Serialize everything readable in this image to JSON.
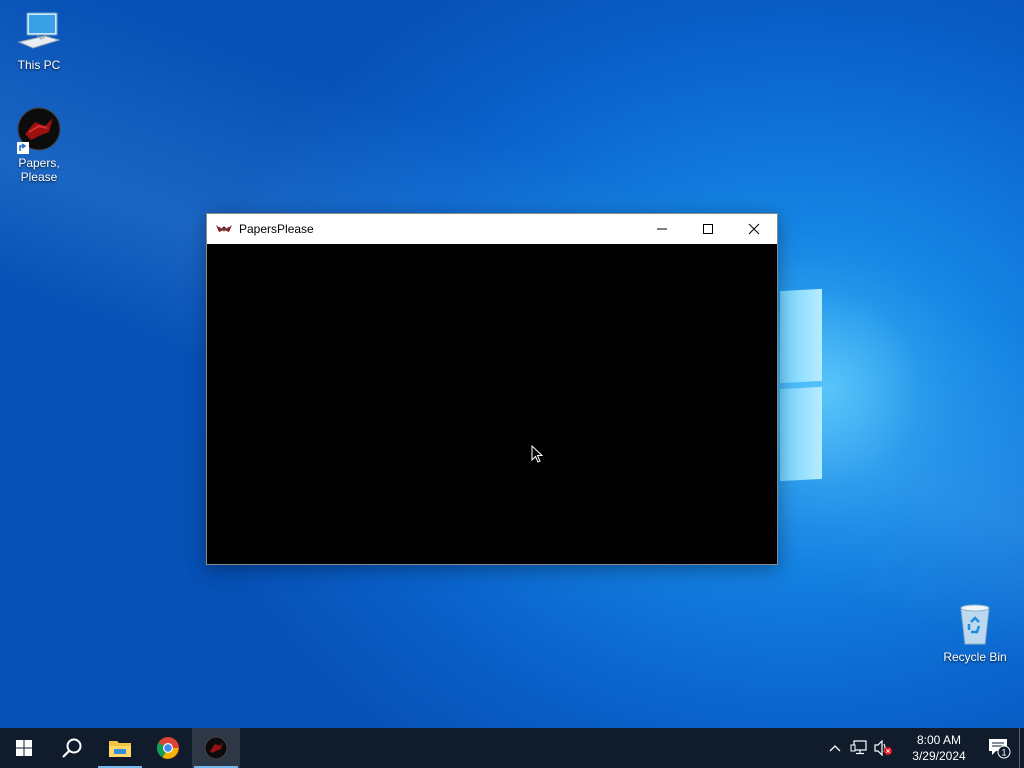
{
  "desktop": {
    "icons": [
      {
        "label": "This PC"
      },
      {
        "label": "Papers, Please"
      },
      {
        "label": "Recycle Bin"
      }
    ]
  },
  "window": {
    "title": "PapersPlease",
    "controls": {
      "minimize": "minimize",
      "maximize": "maximize",
      "close": "close"
    }
  },
  "taskbar": {
    "pinned": [
      "windows-start-icon",
      "search-icon",
      "file-explorer-icon",
      "chrome-icon",
      "papers-please-icon"
    ],
    "active_app": "PapersPlease",
    "clock": {
      "time": "8:00 AM",
      "date": "3/29/2024"
    },
    "notification_count": "1"
  },
  "colors": {
    "taskbar_bg": "#101c2c",
    "desktop_accent": "#0a63cc",
    "active_underline": "#76b9ed"
  }
}
